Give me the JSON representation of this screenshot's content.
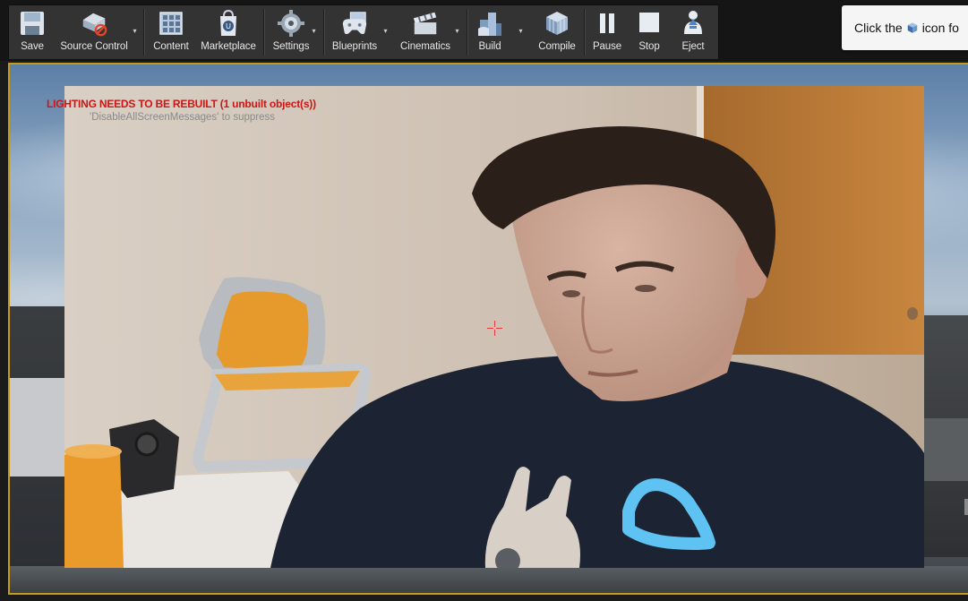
{
  "toolbar": {
    "save": "Save",
    "source_control": "Source Control",
    "content": "Content",
    "marketplace": "Marketplace",
    "settings": "Settings",
    "blueprints": "Blueprints",
    "cinematics": "Cinematics",
    "build": "Build",
    "compile": "Compile",
    "pause": "Pause",
    "stop": "Stop",
    "eject": "Eject"
  },
  "notification": {
    "text_before": "Click the",
    "text_after": "icon fo"
  },
  "viewport": {
    "lighting_warning": "LIGHTING NEEDS TO BE REBUILT (1 unbuilt object(s))",
    "suppress_hint": "'DisableAllScreenMessages' to suppress"
  },
  "colors": {
    "viewport_border": "#c49a1f",
    "warning_text": "#d01515",
    "toolbar_bg": "#333334"
  },
  "icons": [
    "save-icon",
    "source-control-icon",
    "content-icon",
    "marketplace-icon",
    "settings-icon",
    "blueprints-icon",
    "cinematics-icon",
    "build-icon",
    "compile-icon",
    "pause-icon",
    "stop-icon",
    "eject-icon"
  ]
}
